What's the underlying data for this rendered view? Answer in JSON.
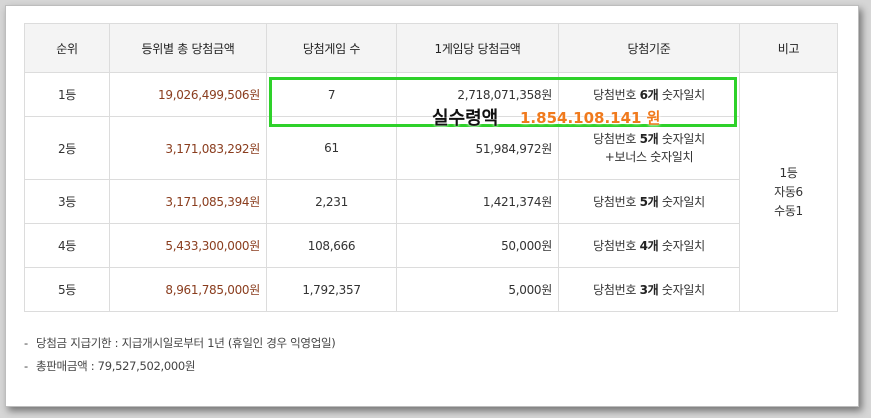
{
  "table": {
    "headers": [
      "순위",
      "등위별 총 당첨금액",
      "당첨게임 수",
      "1게임당 당첨금액",
      "당첨기준",
      "비고"
    ],
    "rows": [
      {
        "rank": "1등",
        "total": "19,026,499,506원",
        "count": "7",
        "per_game": "2,718,071,358원",
        "criteria_pre": "당첨번호 ",
        "criteria_bold": "6개",
        "criteria_post": " 숫자일치",
        "criteria_line2": ""
      },
      {
        "rank": "2등",
        "total": "3,171,083,292원",
        "count": "61",
        "per_game": "51,984,972원",
        "criteria_pre": "당첨번호 ",
        "criteria_bold": "5개",
        "criteria_post": " 숫자일치",
        "criteria_line2": "+보너스 숫자일치"
      },
      {
        "rank": "3등",
        "total": "3,171,085,394원",
        "count": "2,231",
        "per_game": "1,421,374원",
        "criteria_pre": "당첨번호 ",
        "criteria_bold": "5개",
        "criteria_post": " 숫자일치",
        "criteria_line2": ""
      },
      {
        "rank": "4등",
        "total": "5,433,300,000원",
        "count": "108,666",
        "per_game": "50,000원",
        "criteria_pre": "당첨번호 ",
        "criteria_bold": "4개",
        "criteria_post": " 숫자일치",
        "criteria_line2": ""
      },
      {
        "rank": "5등",
        "total": "8,961,785,000원",
        "count": "1,792,357",
        "per_game": "5,000원",
        "criteria_pre": "당첨번호 ",
        "criteria_bold": "3개",
        "criteria_post": " 숫자일치",
        "criteria_line2": ""
      }
    ],
    "remarks": [
      "1등",
      "자동6",
      "수동1"
    ]
  },
  "notes": [
    {
      "dash": "-",
      "text": "당첨금 지급기한 : 지급개시일로부터 1년 (휴일인 경우 익영업일)"
    },
    {
      "dash": "-",
      "text": "총판매금액 : 79,527,502,000원"
    }
  ],
  "overlay": {
    "label": "실수령액",
    "value": "1.854.108.141 원",
    "box_color": "#2ed12a",
    "value_color": "#f07a1d"
  }
}
